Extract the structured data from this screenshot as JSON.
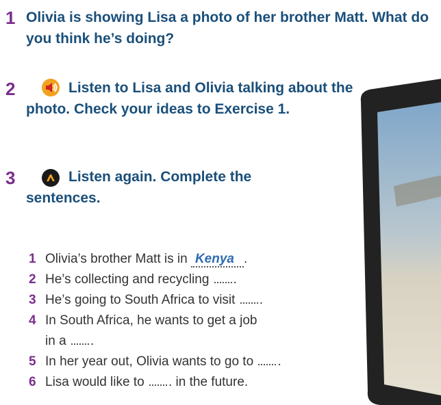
{
  "exercises": [
    {
      "number": "1",
      "text": "Olivia is showing Lisa a photo of her brother Matt. What do you think he’s doing?"
    },
    {
      "number": "2",
      "text": "Listen to Lisa and Olivia talking about the photo. Check your ideas to Exercise 1.",
      "icon": "speaker-icon"
    },
    {
      "number": "3",
      "text": "Listen again. Complete the sentences.",
      "icon": "pencil-icon"
    }
  ],
  "items": [
    {
      "n": "1",
      "before": "Olivia’s brother Matt is in",
      "answer": "Kenya",
      "after": "."
    },
    {
      "n": "2",
      "before": "He’s collecting and recycling",
      "after": "."
    },
    {
      "n": "3",
      "before": "He’s going to South Africa to visit",
      "after": "."
    },
    {
      "n": "4",
      "before": "In South Africa, he wants to get a job",
      "line2": "in a",
      "after": "."
    },
    {
      "n": "5",
      "before": "In her year out, Olivia wants to go to",
      "after": "."
    },
    {
      "n": "6",
      "before": "Lisa would like to",
      "after": ". in the future."
    }
  ],
  "colors": {
    "number": "#7b2d8e",
    "heading": "#1a4f7a",
    "answer": "#2f6bb0"
  }
}
